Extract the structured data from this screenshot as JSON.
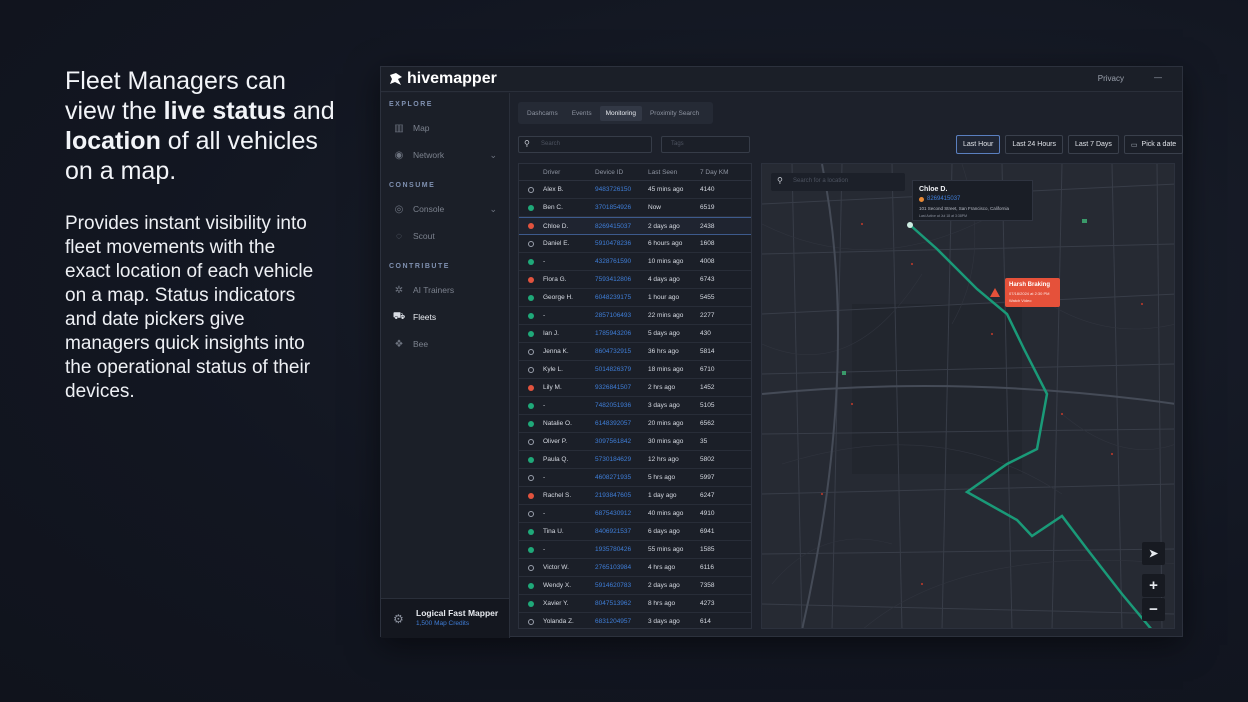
{
  "hero": {
    "line1": "Fleet Managers can",
    "line2_pre": "view the ",
    "line2_bold": "live status",
    "line2_post": " and",
    "line3_bold": "location",
    "line3_post": " of all vehicles",
    "line4": "on a map.",
    "body": "Provides instant visibility into\nfleet movements with the\nexact location of each vehicle\non a map.  Status indicators\nand date pickers give\nmanagers quick insights into\nthe operational status of their\ndevices."
  },
  "app": {
    "logo": "hivemapper",
    "privacy": "Privacy",
    "dash": "—"
  },
  "sidebar": {
    "sections": [
      "EXPLORE",
      "CONSUME",
      "CONTRIBUTE"
    ],
    "items": [
      {
        "label": "Map",
        "icon": "map-icon"
      },
      {
        "label": "Network",
        "icon": "network-icon"
      },
      {
        "label": "Console",
        "icon": "console-icon"
      },
      {
        "label": "Scout",
        "icon": "scout-icon"
      },
      {
        "label": "AI Trainers",
        "icon": "ai-trainers-icon"
      },
      {
        "label": "Fleets",
        "icon": "car-icon"
      },
      {
        "label": "Bee",
        "icon": "bee-icon"
      }
    ],
    "user": {
      "name": "Logical Fast Mapper",
      "credits": "1,500 Map Credits"
    }
  },
  "tabs": [
    "Dashcams",
    "Events",
    "Monitoring",
    "Proximity Search"
  ],
  "search": {
    "placeholder": "Search",
    "tags_placeholder": "Tags"
  },
  "ranges": [
    "Last Hour",
    "Last 24 Hours",
    "Last 7 Days",
    "Pick a date"
  ],
  "table": {
    "headers": [
      "Driver",
      "Device ID",
      "Last Seen",
      "7 Day KM"
    ],
    "rows": [
      {
        "status": "empty",
        "driver": "Alex B.",
        "device": "9483726150",
        "seen": "45 mins ago",
        "km": "4140"
      },
      {
        "status": "green",
        "driver": "Ben C.",
        "device": "3701854926",
        "seen": "Now",
        "km": "6519"
      },
      {
        "status": "red",
        "driver": "Chloe D.",
        "device": "8269415037",
        "seen": "2 days ago",
        "km": "2438"
      },
      {
        "status": "empty",
        "driver": "Daniel E.",
        "device": "5910478236",
        "seen": "6 hours ago",
        "km": "1608"
      },
      {
        "status": "green",
        "driver": "-",
        "device": "4328761590",
        "seen": "10 mins ago",
        "km": "4008"
      },
      {
        "status": "red",
        "driver": "Flora G.",
        "device": "7593412806",
        "seen": "4 days ago",
        "km": "6743"
      },
      {
        "status": "green",
        "driver": "George H.",
        "device": "6048239175",
        "seen": "1 hour ago",
        "km": "5455"
      },
      {
        "status": "green",
        "driver": "-",
        "device": "2857106493",
        "seen": "22 mins ago",
        "km": "2277"
      },
      {
        "status": "green",
        "driver": "Ian J.",
        "device": "1785943206",
        "seen": "5 days ago",
        "km": "430"
      },
      {
        "status": "empty",
        "driver": "Jenna K.",
        "device": "8604732915",
        "seen": "36 hrs ago",
        "km": "5814"
      },
      {
        "status": "empty",
        "driver": "Kyle L.",
        "device": "5014826379",
        "seen": "18 mins ago",
        "km": "6710"
      },
      {
        "status": "red",
        "driver": "Lily M.",
        "device": "9326841507",
        "seen": "2 hrs ago",
        "km": "1452"
      },
      {
        "status": "green",
        "driver": "-",
        "device": "7482051936",
        "seen": "3 days ago",
        "km": "5105"
      },
      {
        "status": "green",
        "driver": "Natalie O.",
        "device": "6148392057",
        "seen": "20 mins ago",
        "km": "6562"
      },
      {
        "status": "empty",
        "driver": "Oliver P.",
        "device": "3097561842",
        "seen": "30 mins ago",
        "km": "35"
      },
      {
        "status": "green",
        "driver": "Paula Q.",
        "device": "5730184629",
        "seen": "12 hrs ago",
        "km": "5802"
      },
      {
        "status": "empty",
        "driver": "-",
        "device": "4608271935",
        "seen": "5 hrs ago",
        "km": "5997"
      },
      {
        "status": "red",
        "driver": "Rachel S.",
        "device": "2193847605",
        "seen": "1 day ago",
        "km": "6247"
      },
      {
        "status": "empty",
        "driver": "-",
        "device": "6875430912",
        "seen": "40 mins ago",
        "km": "4910"
      },
      {
        "status": "green",
        "driver": "Tina U.",
        "device": "8406921537",
        "seen": "6 days ago",
        "km": "6941"
      },
      {
        "status": "green",
        "driver": "-",
        "device": "1935780426",
        "seen": "55 mins ago",
        "km": "1585"
      },
      {
        "status": "empty",
        "driver": "Victor W.",
        "device": "2765103984",
        "seen": "4 hrs ago",
        "km": "6116"
      },
      {
        "status": "green",
        "driver": "Wendy X.",
        "device": "5914620783",
        "seen": "2 days ago",
        "km": "7358"
      },
      {
        "status": "green",
        "driver": "Xavier Y.",
        "device": "8047513962",
        "seen": "8 hrs ago",
        "km": "4273"
      },
      {
        "status": "empty",
        "driver": "Yolanda Z.",
        "device": "6831204957",
        "seen": "3 days ago",
        "km": "614"
      }
    ]
  },
  "map": {
    "search_placeholder": "Search for a location",
    "popup": {
      "name": "Chloe D.",
      "device": "8269415037",
      "address": "101 Second Street, San Francisco, California",
      "last_seen": "Last Active at Jul 18 at 3:38PM"
    },
    "alert": {
      "title": "Harsh Braking",
      "date": "07/18/2024 at 2:30 PM",
      "link": "Watch Video"
    },
    "route_color": "#1a9a78",
    "alert_color": "#e5513a",
    "zoom_in": "+",
    "zoom_out": "−"
  },
  "colors": {
    "green": "#1fa979",
    "red": "#e2533e",
    "link": "#3f7ed8"
  }
}
